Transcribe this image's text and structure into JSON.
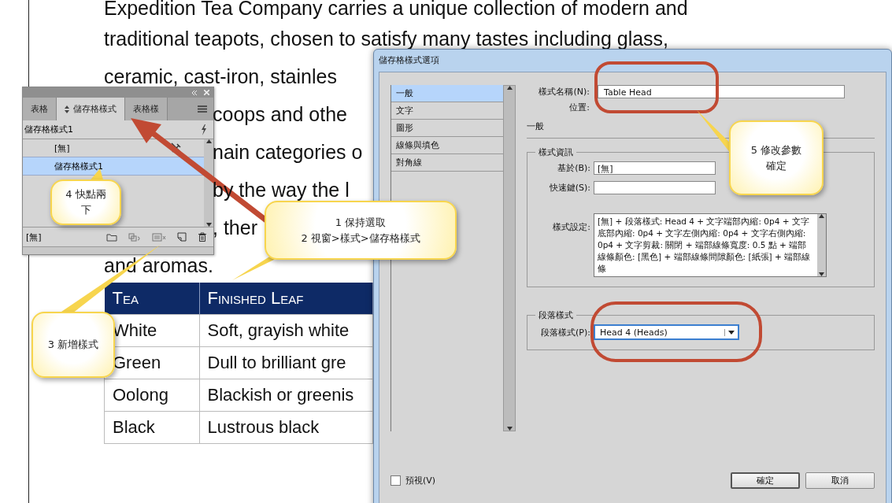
{
  "document": {
    "lines": [
      {
        "text": "Expedition Tea Company carries a unique collection of modern and"
      },
      {
        "text": "traditional teapots, chosen to satisfy many tastes including glass,"
      },
      {
        "text": "ceramic, cast-iron, stainles"
      },
      {
        "text": "coops and othe"
      },
      {
        "text": "nain categories o"
      },
      {
        "text": "by the way the l"
      },
      {
        "text": ", ther"
      },
      {
        "text": "and aromas."
      }
    ],
    "table": {
      "columns": [
        "Tea",
        "Finished Leaf"
      ],
      "rows": [
        [
          "White",
          "Soft, grayish white"
        ],
        [
          "Green",
          "Dull to brilliant gre"
        ],
        [
          "Oolong",
          "Blackish or greenis"
        ],
        [
          "Black",
          "Lustrous black"
        ]
      ]
    }
  },
  "panel": {
    "tabs": [
      {
        "label": "表格",
        "selected": false
      },
      {
        "label": "儲存格樣式",
        "selected": true
      },
      {
        "label": "表格樣",
        "selected": false
      }
    ],
    "current_style": "儲存格樣式1",
    "styles": [
      {
        "label": "[無]",
        "selected": false
      },
      {
        "label": "儲存格樣式1",
        "selected": true
      }
    ],
    "footer_label": "[無]"
  },
  "dialog": {
    "title": "儲存格樣式選項",
    "categories": [
      {
        "label": "一般",
        "selected": true
      },
      {
        "label": "文字",
        "selected": false
      },
      {
        "label": "圖形",
        "selected": false
      },
      {
        "label": "線條與填色",
        "selected": false
      },
      {
        "label": "對角線",
        "selected": false
      }
    ],
    "style_name_label": "樣式名稱(N):",
    "style_name": "Table Head",
    "location_label": "位置:",
    "section_title": "一般",
    "style_info": {
      "legend": "樣式資訊",
      "based_on_label": "基於(B):",
      "based_on": "[無]",
      "shortcut_label": "快速鍵(S):",
      "settings_label": "樣式設定:",
      "settings": "[無] + 段落樣式: Head 4 + 文字端部內縮: 0p4 + 文字底部內縮: 0p4 + 文字左側內縮: 0p4 + 文字右側內縮: 0p4 + 文字剪裁: 關閉 + 端部線條寬度: 0.5 點 + 端部線條顏色: [黑色] + 端部線條間隙顏色: [紙張] + 端部線條"
    },
    "paragraph_style": {
      "legend": "段落樣式",
      "label": "段落樣式(P):",
      "value": "Head 4 (Heads)"
    },
    "preview": {
      "label": "預視(V)",
      "checked": false
    },
    "buttons": [
      "確定",
      "取消"
    ]
  },
  "callouts": [
    {
      "lines": [
        "1 保持選取",
        "2 視窗>樣式>儲存格樣式"
      ]
    },
    {
      "lines": [
        "3 新增樣式"
      ]
    },
    {
      "lines": [
        "4 快點兩",
        "下"
      ]
    },
    {
      "lines": [
        "5 修改參數",
        "確定"
      ]
    }
  ]
}
